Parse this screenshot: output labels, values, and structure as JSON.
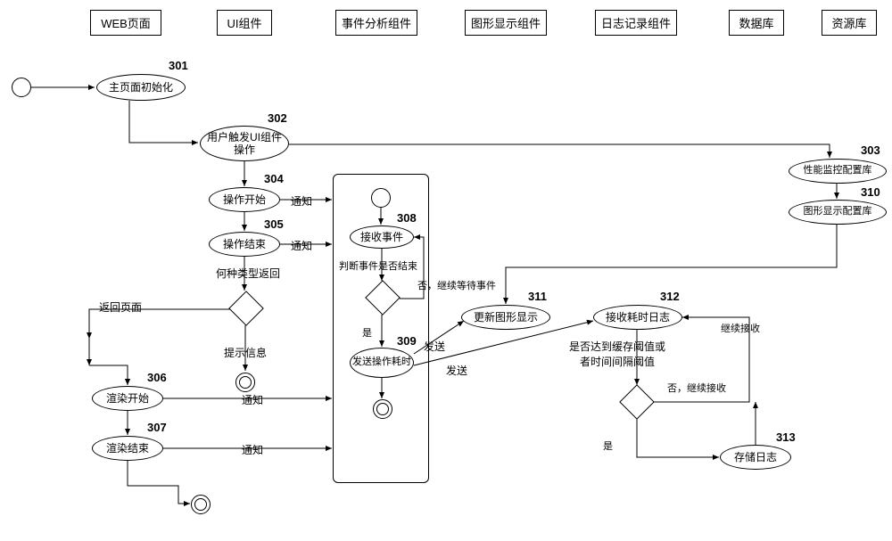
{
  "lanes": {
    "web": "WEB页面",
    "ui": "UI组件",
    "event": "事件分析组件",
    "graph": "图形显示组件",
    "log": "日志记录组件",
    "db": "数据库",
    "repo": "资源库"
  },
  "nodes": {
    "n301": {
      "num": "301",
      "label": "主页面初始化"
    },
    "n302": {
      "num": "302",
      "label": "用户触发UI组件操作"
    },
    "n303": {
      "num": "303",
      "label": "性能监控配置库"
    },
    "n304": {
      "num": "304",
      "label": "操作开始"
    },
    "n305": {
      "num": "305",
      "label": "操作结束"
    },
    "n306": {
      "num": "306",
      "label": "渲染开始"
    },
    "n307": {
      "num": "307",
      "label": "渲染结束"
    },
    "n308": {
      "num": "308",
      "label": "接收事件"
    },
    "n309": {
      "num": "309",
      "label": "发送操作耗时"
    },
    "n310": {
      "num": "310",
      "label": "图形显示配置库"
    },
    "n311": {
      "num": "311",
      "label": "更新图形显示"
    },
    "n312": {
      "num": "312",
      "label": "接收耗时日志"
    },
    "n313": {
      "num": "313",
      "label": "存储日志"
    }
  },
  "edges": {
    "notify1": "通知",
    "notify2": "通知",
    "notify3": "通知",
    "notify4": "通知",
    "returnType": "何种类型返回",
    "returnPage": "返回页面",
    "hintInfo": "提示信息",
    "judgeEnd": "判断事件是否结束",
    "noWait": "否，继续等待事件",
    "yes1": "是",
    "send1": "发送",
    "send2": "发送",
    "thresholdQ": "是否达到缓存阈值或者时间间隔阈值",
    "noContinue": "否，继续接收",
    "continueRecv": "继续接收",
    "yes2": "是"
  }
}
